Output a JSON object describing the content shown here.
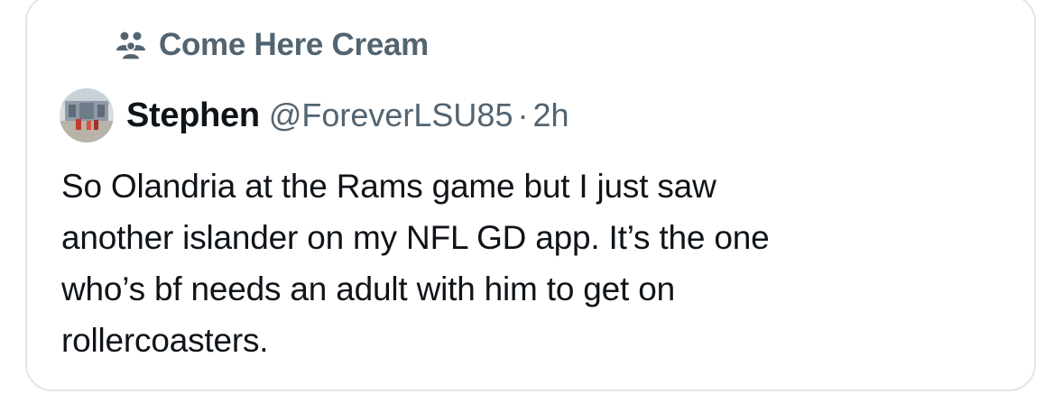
{
  "community": {
    "icon": "community-icon",
    "name": "Come Here Cream"
  },
  "author": {
    "avatar": "avatar",
    "display_name": "Stephen",
    "handle": "@ForeverLSU85",
    "separator": "·",
    "time": "2h"
  },
  "tweet": {
    "lines": [
      "So Olandria at the Rams game but I just saw",
      "another islander on my NFL GD app. It’s the one",
      "who’s bf needs an adult with him to get on",
      "rollercoasters."
    ]
  },
  "colors": {
    "text_primary": "#0f1419",
    "text_secondary": "#536471",
    "border": "#e2e5e8"
  }
}
